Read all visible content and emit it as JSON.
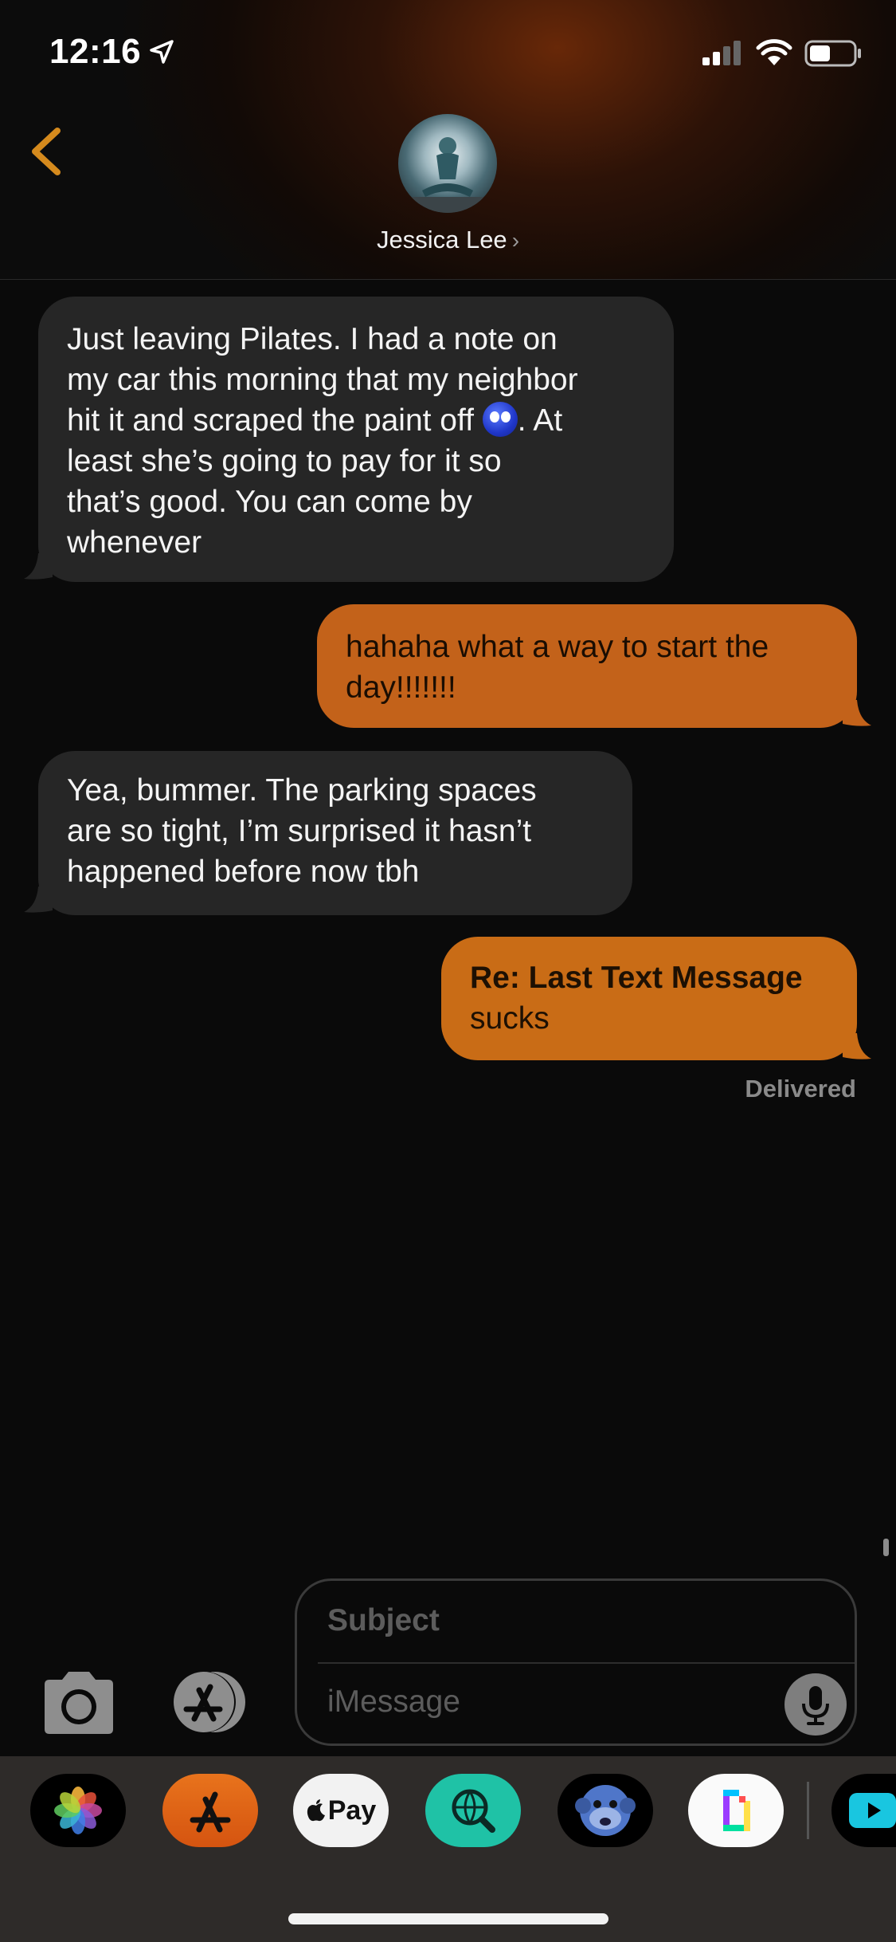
{
  "status_bar": {
    "time": "12:16"
  },
  "header": {
    "contact_name": "Jessica Lee",
    "name_chevron": "›"
  },
  "messages": [
    {
      "direction": "incoming",
      "text_before_emoji": "Just leaving Pilates. I had a note on\nmy car this morning that my neighbor\nhit it and scraped the paint off ",
      "emoji": "eye-roll-emoji",
      "text_after_emoji": ". At\nleast she’s going to pay for it so\nthat’s good. You can come by\nwhenever"
    },
    {
      "direction": "outgoing",
      "text": "hahaha what a way to start the\nday!!!!!!!"
    },
    {
      "direction": "incoming",
      "text": "Yea, bummer. The parking spaces\nare so tight, I’m surprised it hasn’t\nhappened before now tbh"
    },
    {
      "direction": "outgoing",
      "subject": "Re: Last Text Message",
      "text": "sucks"
    }
  ],
  "delivery_status": "Delivered",
  "compose": {
    "subject_placeholder": "Subject",
    "message_placeholder": "iMessage"
  },
  "app_tray": {
    "items": [
      "photos-app-icon",
      "app-store-icon",
      "apple-pay-icon",
      "web-search-icon",
      "memoji-icon",
      "giphy-icon",
      "video-app-icon"
    ],
    "apple_pay_label": "Pay"
  },
  "colors": {
    "accent": "#d58a1d",
    "outgoing_bubble": "#c3621a",
    "incoming_bubble": "#262626",
    "background": "#0a0a0a"
  }
}
